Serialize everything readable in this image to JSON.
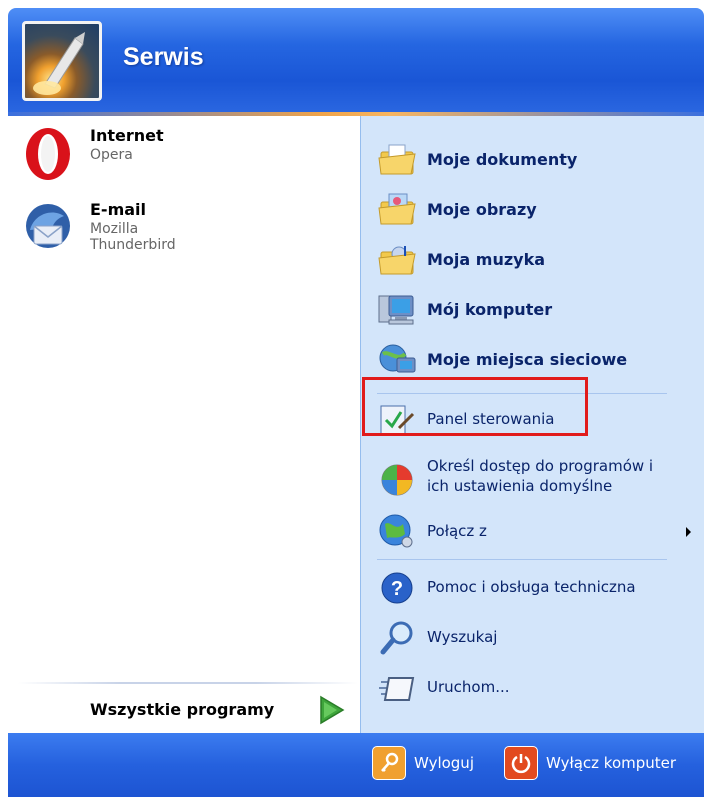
{
  "header": {
    "user_name": "Serwis"
  },
  "pinned": [
    {
      "title": "Internet",
      "subtitle": "Opera",
      "icon": "opera-icon"
    },
    {
      "title": "E-mail",
      "subtitle": "Mozilla Thunderbird",
      "icon": "thunderbird-icon"
    }
  ],
  "all_programs_label": "Wszystkie programy",
  "places": [
    {
      "label": "Moje dokumenty",
      "icon": "folder-documents-icon"
    },
    {
      "label": "Moje obrazy",
      "icon": "folder-pictures-icon"
    },
    {
      "label": "Moja muzyka",
      "icon": "folder-music-icon"
    },
    {
      "label": "Mój komputer",
      "icon": "computer-icon"
    },
    {
      "label": "Moje miejsca sieciowe",
      "icon": "network-places-icon"
    }
  ],
  "system": {
    "control_panel": "Panel sterowania",
    "set_access_line1": "Określ dostęp do programów i",
    "set_access_line2": "ich ustawienia domyślne",
    "connect_to": "Połącz z",
    "help": "Pomoc i obsługa techniczna",
    "search": "Wyszukaj",
    "run": "Uruchom..."
  },
  "footer": {
    "logoff": "Wyloguj",
    "shutdown": "Wyłącz komputer"
  },
  "colors": {
    "header_blue": "#2566e1",
    "right_panel": "#d3e5fa",
    "highlight_border": "#e11b1b"
  }
}
